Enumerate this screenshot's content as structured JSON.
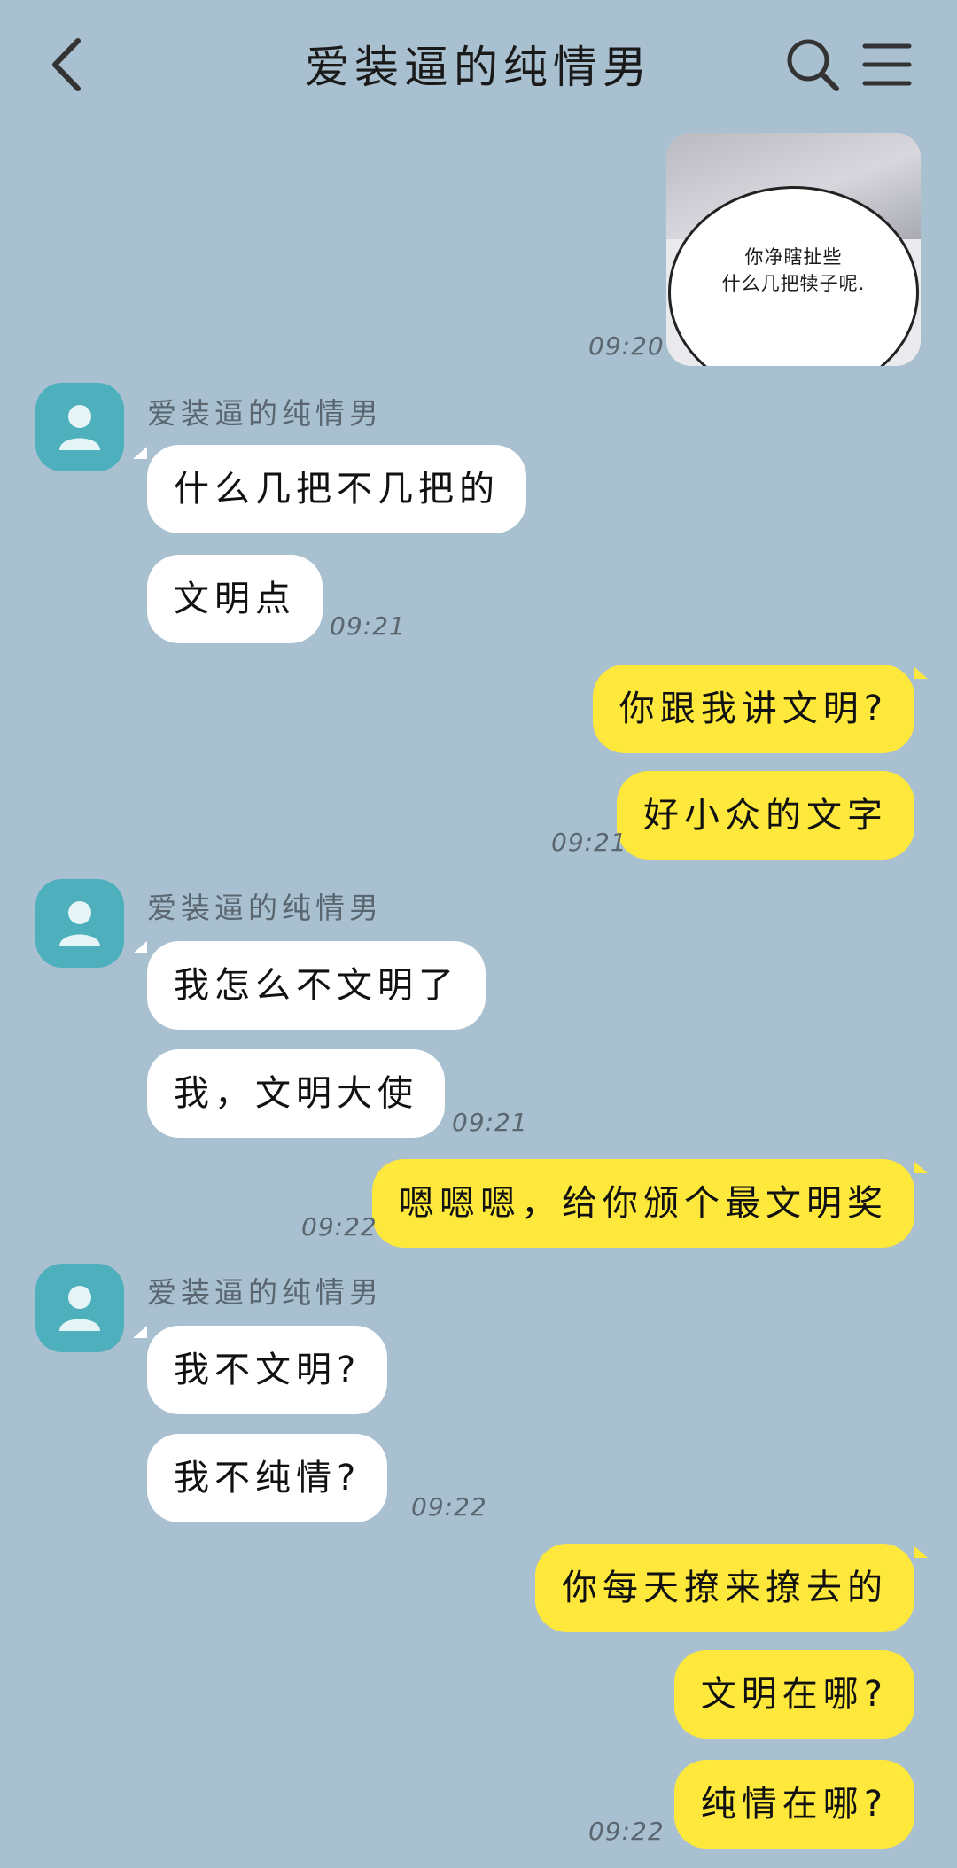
{
  "header": {
    "title": "爱装逼的纯情男",
    "back_icon": "chevron-left-icon",
    "search_icon": "search-icon",
    "menu_icon": "menu-icon"
  },
  "colors": {
    "background": "#a9c0d0",
    "incoming_bubble": "#ffffff",
    "outgoing_bubble": "#fde83b",
    "avatar": "#4fb0bd"
  },
  "image_message": {
    "lines": [
      "你净瞎扯些",
      "什么几把犊子呢."
    ],
    "time": "09:20"
  },
  "groups": [
    {
      "sender": "爱装逼的纯情男",
      "messages": [
        "什么几把不几把的",
        "文明点"
      ],
      "time": "09:21"
    },
    {
      "outgoing": true,
      "messages": [
        "你跟我讲文明?",
        "好小众的文字"
      ],
      "time": "09:21"
    },
    {
      "sender": "爱装逼的纯情男",
      "messages": [
        "我怎么不文明了",
        "我，文明大使"
      ],
      "time": "09:21"
    },
    {
      "outgoing": true,
      "messages": [
        "嗯嗯嗯，给你颁个最文明奖"
      ],
      "time": "09:22"
    },
    {
      "sender": "爱装逼的纯情男",
      "messages": [
        "我不文明?",
        "我不纯情?"
      ],
      "time": "09:22"
    },
    {
      "outgoing": true,
      "messages": [
        "你每天撩来撩去的",
        "文明在哪?",
        "纯情在哪?"
      ],
      "time": "09:22"
    }
  ]
}
